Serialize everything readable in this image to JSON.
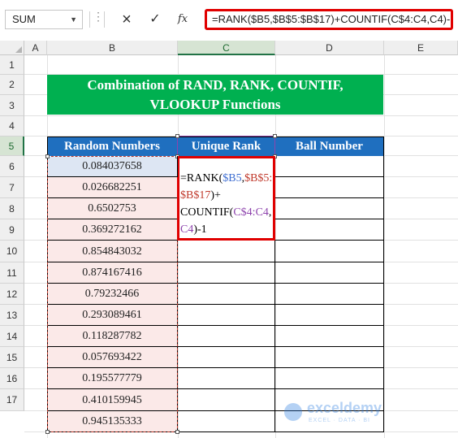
{
  "formula_bar": {
    "name_box": "SUM",
    "cancel_icon": "×",
    "enter_icon": "✓",
    "fx_label": "fx",
    "formula": "=RANK($B5,$B$5:$B$17)+COUNTIF(C$4:C4,C4)-1"
  },
  "columns": [
    "A",
    "B",
    "C",
    "D",
    "E"
  ],
  "rows": [
    "1",
    "2",
    "3",
    "4",
    "5",
    "6",
    "7",
    "8",
    "9",
    "10",
    "11",
    "12",
    "13",
    "14",
    "15",
    "16",
    "17"
  ],
  "title": {
    "line1": "Combination of RAND, RANK, COUNTIF,",
    "line2": "VLOOKUP Functions"
  },
  "table": {
    "headers": [
      "Random Numbers",
      "Unique Rank",
      "Ball Number"
    ],
    "random_numbers": [
      "0.084037658",
      "0.026682251",
      "0.6502753",
      "0.369272162",
      "0.854843032",
      "0.874167416",
      "0.79232466",
      "0.293089461",
      "0.118287782",
      "0.057693422",
      "0.195577779",
      "0.410159945",
      "0.945135333"
    ]
  },
  "editing_cell": {
    "p1": "=RANK(",
    "p2": "$B5",
    "p3": ",",
    "p4": "$B$5:",
    "p5": "$B$17",
    "p6": ")+",
    "p7": "COUNTIF(",
    "p8": "C$4:C4",
    "p9": ",",
    "p10": "C4",
    "p11": ")-1"
  },
  "watermark": {
    "brand": "exceldemy",
    "tagline": "EXCEL · DATA · BI"
  },
  "colors": {
    "title_bg": "#00b050",
    "header_bg": "#1f6fbf",
    "highlight_red": "#e00000",
    "ref_blue": "#3d6dd1",
    "ref_red": "#c0392b",
    "ref_purple": "#8e44ad"
  }
}
